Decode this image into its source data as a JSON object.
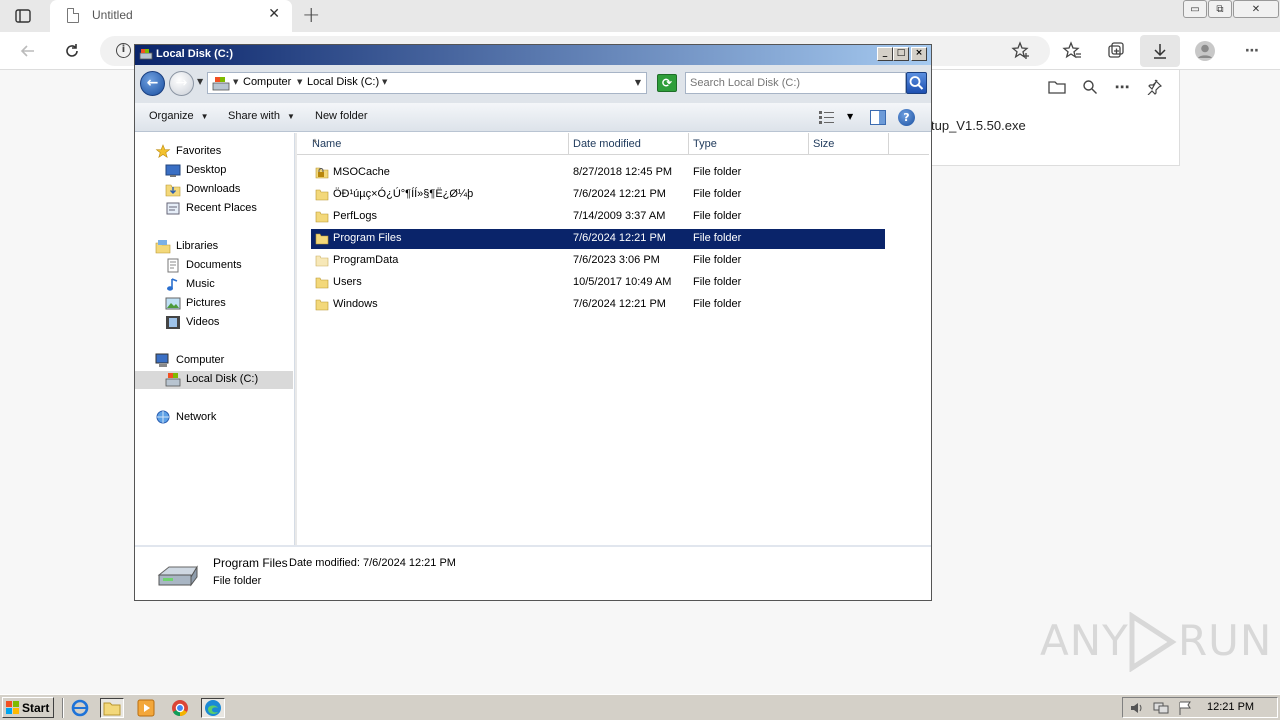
{
  "browser": {
    "tab_title": "Untitled",
    "tab_close": "✕",
    "new_tab": "+",
    "win_minimize": "▭",
    "win_restore": "⧉",
    "win_close": "✕",
    "site_info": "i",
    "download_item_filename": "tup_V1.5.50.exe"
  },
  "explorer": {
    "window_title": "Local Disk (C:)",
    "breadcrumb": [
      "Computer",
      "Local Disk (C:)"
    ],
    "search_placeholder": "Search Local Disk (C:)",
    "commands": {
      "organize": "Organize",
      "share_with": "Share with",
      "new_folder": "New folder"
    },
    "nav_pane": {
      "favorites": "Favorites",
      "desktop": "Desktop",
      "downloads": "Downloads",
      "recent_places": "Recent Places",
      "libraries": "Libraries",
      "documents": "Documents",
      "music": "Music",
      "pictures": "Pictures",
      "videos": "Videos",
      "computer": "Computer",
      "local_disk": "Local Disk (C:)",
      "network": "Network"
    },
    "columns": {
      "name": "Name",
      "date_modified": "Date modified",
      "type": "Type",
      "size": "Size"
    },
    "files": [
      {
        "name": "MSOCache",
        "date": "8/27/2018 12:45 PM",
        "type": "File folder",
        "locked": true
      },
      {
        "name": "ÖÐ¹úµç×Ó¿Ú°¶ÍÍ»§¶Ë¿Ø¼þ",
        "date": "7/6/2024 12:21 PM",
        "type": "File folder"
      },
      {
        "name": "PerfLogs",
        "date": "7/14/2009 3:37 AM",
        "type": "File folder"
      },
      {
        "name": "Program Files",
        "date": "7/6/2024 12:21 PM",
        "type": "File folder",
        "selected": true
      },
      {
        "name": "ProgramData",
        "date": "7/6/2023 3:06 PM",
        "type": "File folder"
      },
      {
        "name": "Users",
        "date": "10/5/2017 10:49 AM",
        "type": "File folder"
      },
      {
        "name": "Windows",
        "date": "7/6/2024 12:21 PM",
        "type": "File folder"
      }
    ],
    "details": {
      "name": "Program Files",
      "date_label": "Date modified:",
      "date_value": "7/6/2024 12:21 PM",
      "type": "File folder"
    }
  },
  "taskbar": {
    "start_label": "Start",
    "clock": "12:21 PM"
  },
  "watermark": {
    "text_left": "ANY",
    "text_right": "RUN"
  },
  "colors": {
    "selection": "#0a246a",
    "taskbar": "#d4d0c8",
    "title_gradient_start": "#0a246a",
    "title_gradient_end": "#a6caf0"
  }
}
